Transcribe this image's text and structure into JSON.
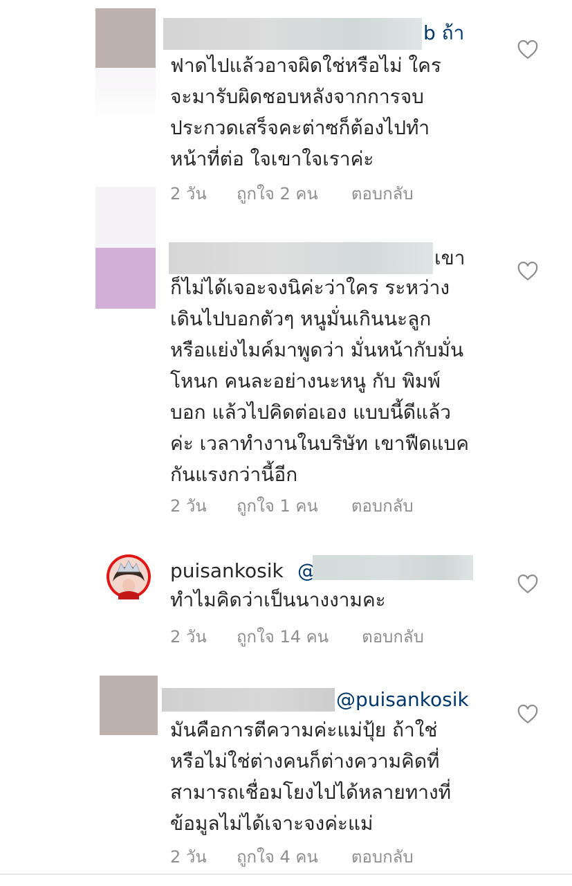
{
  "comments": [
    {
      "trail": "b ถ้า",
      "text": "ฟาดไปแล้วอาจผิดใช่หรือไม่ ใคร\nจะมารับผิดชอบหลังจากการจบ\nประกวดเสร็จคะต่าซก็ต้องไปทำ\nหน้าที่ต่อ ใจเขาใจเราค่ะ",
      "time": "2 วัน",
      "likes": "ถูกใจ 2 คน",
      "reply": "ตอบกลับ",
      "like_icon": "heart-outline-icon"
    },
    {
      "trail": "เขา",
      "text": "ก็ไม่ได้เจอะจงนิค่ะว่าใคร ระหว่าง\nเดินไปบอกตัวๆ หนูมั่นเกินนะลูก\nหรือแย่งไมค์มาพูดว่า มั่นหน้ากับมั่น\nโหนก คนละอย่างนะหนู กับ พิมพ์\nบอก แล้วไปคิดต่อเอง แบบนี้ดีแล้ว\nค่ะ เวลาทำงานในบริษัท เขาฟืดแบค\nกันแรงกว่านี้อีก",
      "time": "2 วัน",
      "likes": "ถูกใจ 1 คน",
      "reply": "ตอบกลับ",
      "like_icon": "heart-outline-icon"
    },
    {
      "username": "puisankosik",
      "mention": "@",
      "text": "ทำไมคิดว่าเป็นนางงามคะ",
      "time": "2 วัน",
      "likes": "ถูกใจ 14 คน",
      "reply": "ตอบกลับ",
      "like_icon": "heart-outline-icon"
    },
    {
      "mention": "@puisankosik",
      "text": "มันคือการตีความค่ะแม่ปุ้ย ถ้าใช่\nหรือไม่ใช่ต่างคนก็ต่างความคิดที่\nสามารถเชื่อมโยงไปได้หลายทางที่\nข้อมูลไม่ได้เจาะจงค่ะแม่",
      "time": "2 วัน",
      "likes": "ถูกใจ 4 คน",
      "reply": "ตอบกลับ",
      "like_icon": "heart-outline-icon"
    }
  ],
  "colors": {
    "text": "#262626",
    "meta": "#8e8e8e",
    "mention": "#00376b",
    "avatar_placeholder_1": "#bdb1ad",
    "avatar_placeholder_2": "#d2b0d6",
    "avatar_ring": "#e01717",
    "redaction": "#d7d7d7"
  }
}
